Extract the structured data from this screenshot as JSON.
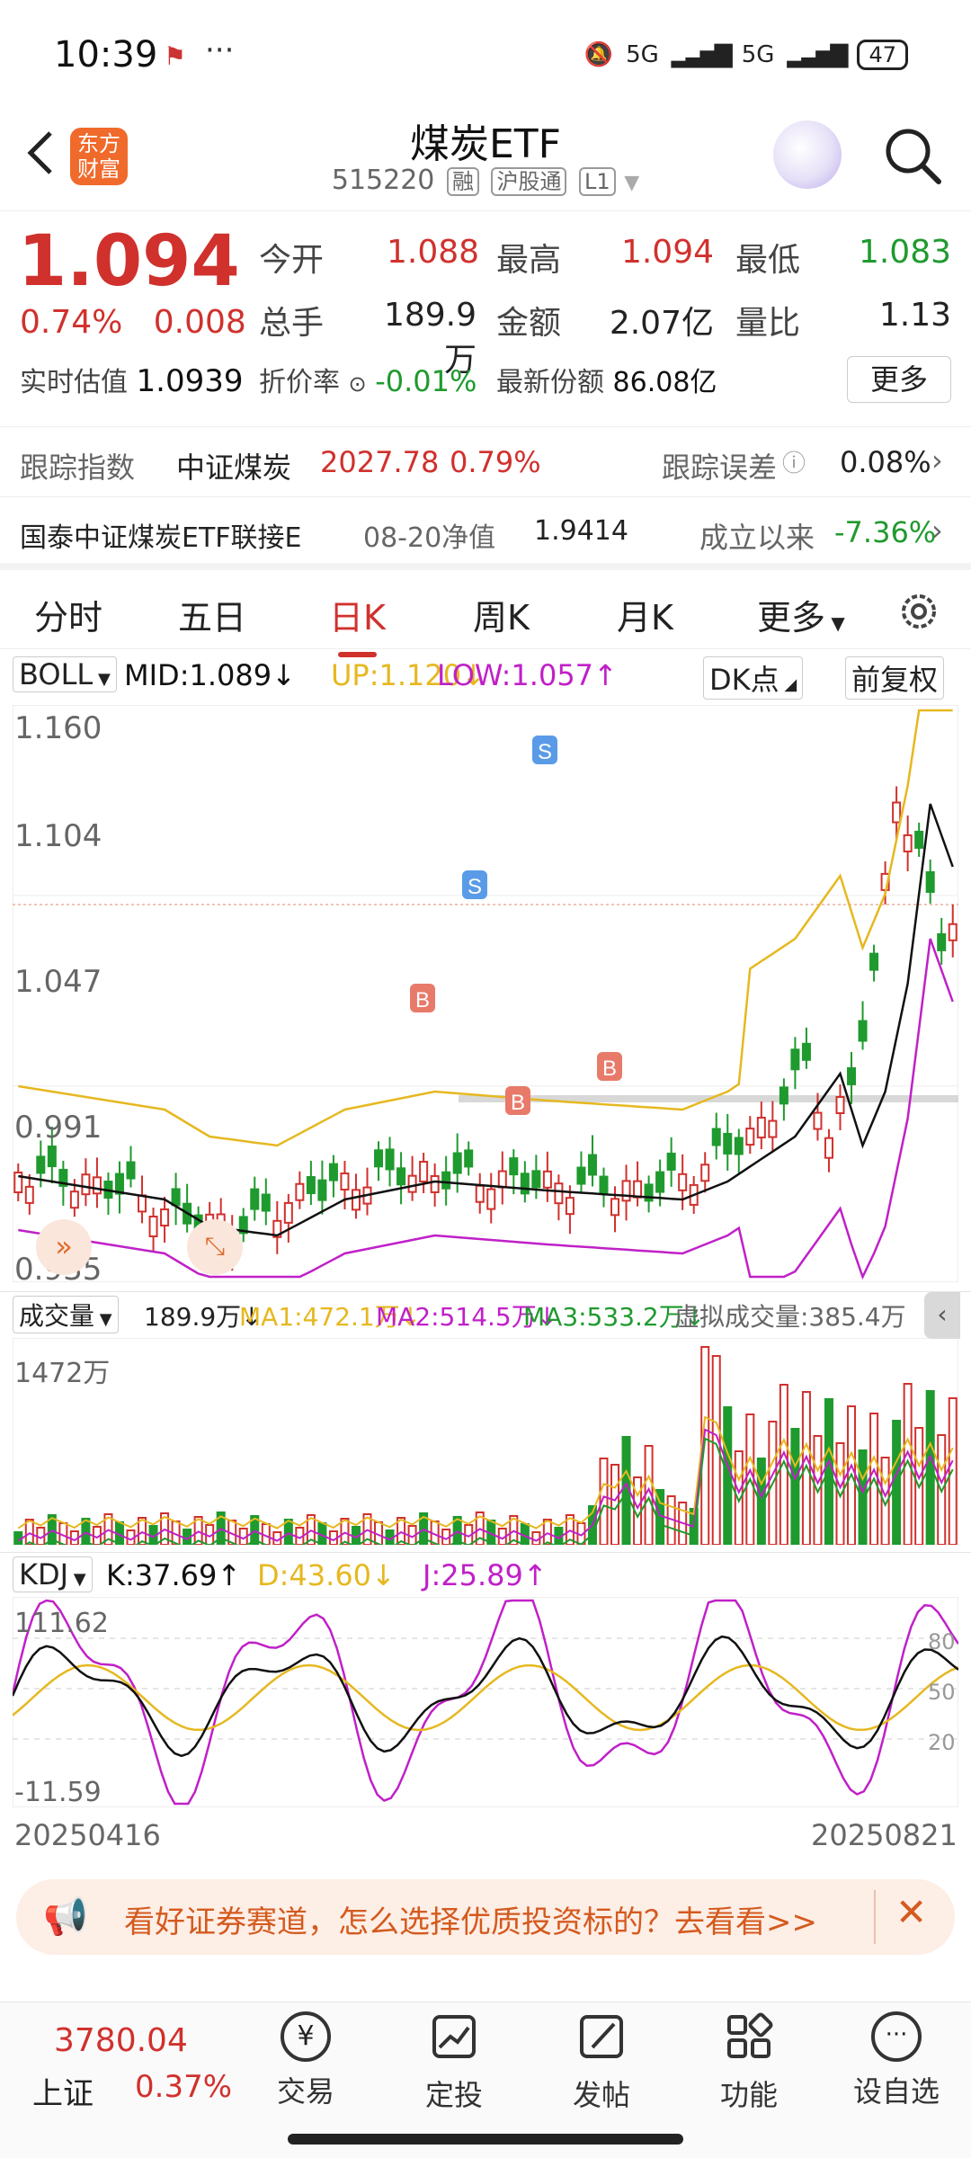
{
  "status": {
    "time": "10:39",
    "signal1": "5G",
    "signal2": "5G",
    "battery": "47"
  },
  "header": {
    "logo_text": "东方\n财富",
    "title": "煤炭ETF",
    "code": "515220",
    "tag1": "融",
    "tag2": "沪股通",
    "tag3": "L1"
  },
  "quote": {
    "price": "1.094",
    "change_pct": "0.74%",
    "change": "0.008",
    "open_label": "今开",
    "open": "1.088",
    "high_label": "最高",
    "high": "1.094",
    "low_label": "最低",
    "low": "1.083",
    "vol_label": "总手",
    "vol": "189.9万",
    "amt_label": "金额",
    "amt": "2.07亿",
    "ratio_label": "量比",
    "ratio": "1.13",
    "est_label": "实时估值",
    "est": "1.0939",
    "disc_label": "折价率",
    "disc": "-0.01%",
    "shares_label": "最新份额",
    "shares": "86.08亿",
    "more": "更多",
    "track_label": "跟踪指数",
    "track_name": "中证煤炭",
    "track_val": "2027.78",
    "track_pct": "0.79%",
    "err_label": "跟踪误差",
    "err_val": "0.08%",
    "fund_name": "国泰中证煤炭ETF联接E",
    "nav_label": "08-20净值",
    "nav": "1.9414",
    "since_label": "成立以来",
    "since": "-7.36%"
  },
  "tabs": [
    "分时",
    "五日",
    "日K",
    "周K",
    "月K",
    "更多"
  ],
  "boll": {
    "name": "BOLL",
    "mid": "MID:1.089",
    "up": "UP:1.120",
    "low": "LOW:1.057",
    "dk": "DK点",
    "adj": "前复权",
    "y1": "1.160",
    "y2": "1.104",
    "y3": "1.047",
    "y4": "0.991",
    "y5": "0.935"
  },
  "volume": {
    "name": "成交量",
    "vol": "189.9万",
    "ma1": "MA1:472.1万",
    "ma2": "MA2:514.5万",
    "ma3": "MA3:533.2万",
    "virtual": "虚拟成交量:385.4万",
    "ymax": "1472万"
  },
  "kdj": {
    "name": "KDJ",
    "k": "K:37.69",
    "d": "D:43.60",
    "j": "J:25.89",
    "ytop": "111.62",
    "ybot": "-11.59",
    "l80": "80",
    "l50": "50",
    "l20": "20"
  },
  "dates": {
    "start": "20250416",
    "end": "20250821"
  },
  "banner": {
    "text": "看好证券赛道，怎么选择优质投资标的？去看看>>"
  },
  "bottom": {
    "index_val": "3780.04",
    "index_name": "上证",
    "index_pct": "0.37%",
    "items": [
      "交易",
      "定投",
      "发帖",
      "功能",
      "设自选"
    ]
  },
  "colors": {
    "up": "#d0312d",
    "down": "#1f9a2e",
    "mid": "#111111",
    "upband": "#e6b820",
    "lowband": "#c020c8"
  }
}
